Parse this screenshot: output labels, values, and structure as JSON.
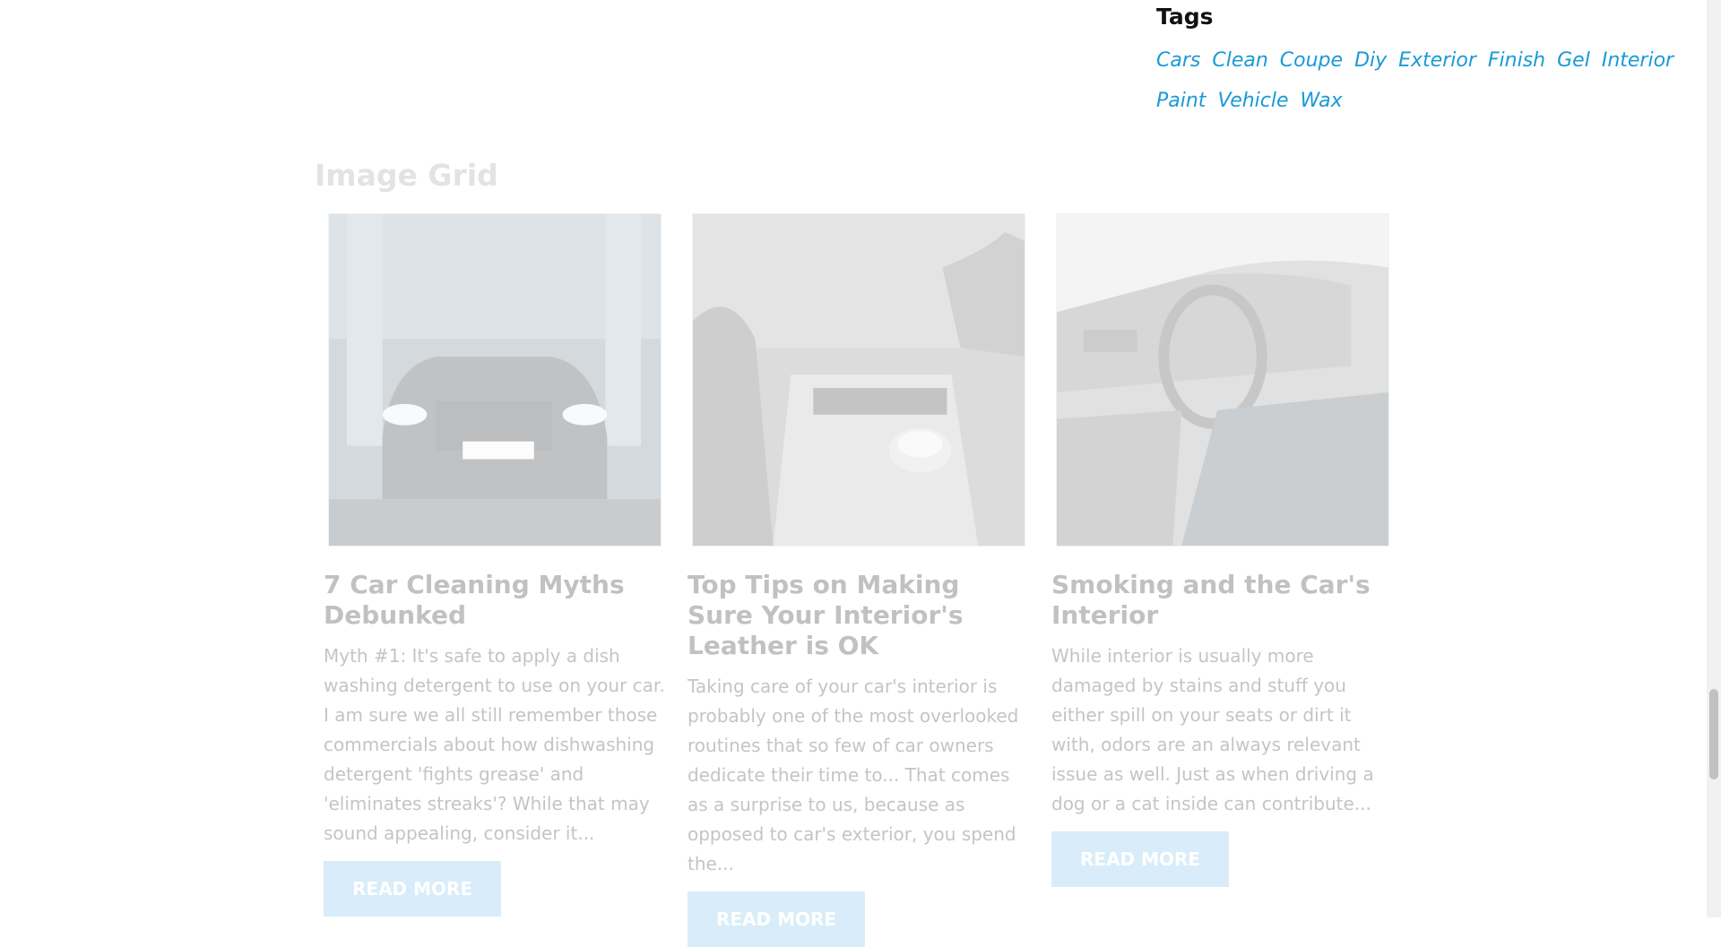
{
  "tags": {
    "title": "Tags",
    "items": [
      "Cars",
      "Clean",
      "Coupe",
      "Diy",
      "Exterior",
      "Finish",
      "Gel",
      "Interior",
      "Paint",
      "Vehicle",
      "Wax"
    ]
  },
  "image_grid": {
    "heading": "Image Grid",
    "cards": [
      {
        "title": "7 Car Cleaning Myths Debunked",
        "excerpt": "Myth #1: It's safe to apply a dish washing detergent to use on your car. I am sure we all still remember those commercials about how dishwashing detergent 'fights grease' and 'eliminates streaks'? While that may sound appealing, consider it...",
        "button": "READ MORE"
      },
      {
        "title": "Top Tips on Making Sure Your Interior's Leather is OK",
        "excerpt": "Taking care of your car's interior is probably one of the most overlooked routines that so few of car owners dedicate their time to... That comes as a surprise to us, because as opposed to car's exterior, you spend the...",
        "button": "READ MORE"
      },
      {
        "title": "Smoking and the Car's Interior",
        "excerpt": "While interior is usually more damaged by stains and stuff you either spill on your seats or dirt it with, odors are an always relevant issue as well. Just as when driving a dog or a cat inside can contribute...",
        "button": "READ MORE"
      }
    ]
  },
  "colors": {
    "tag_link": "#1a9ad6",
    "button_bg": "#7ec4ea"
  }
}
